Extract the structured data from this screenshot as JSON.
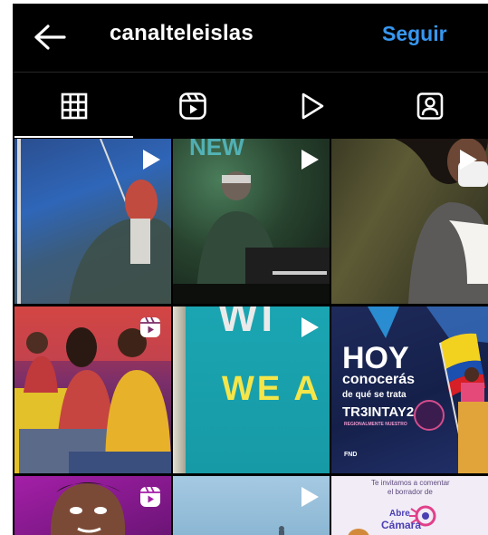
{
  "header": {
    "back_icon": "arrow-left-icon",
    "username": "canalteleislas",
    "follow_label": "Seguir"
  },
  "tabs": [
    {
      "icon": "grid-icon",
      "active": true
    },
    {
      "icon": "reels-icon",
      "active": false
    },
    {
      "icon": "play-icon",
      "active": false
    },
    {
      "icon": "tagged-person-icon",
      "active": false
    }
  ],
  "posts": [
    {
      "type": "video",
      "badge_icon": "play-icon"
    },
    {
      "type": "video",
      "badge_icon": "play-icon",
      "text": "NEW"
    },
    {
      "type": "video",
      "badge_icon": "play-icon"
    },
    {
      "type": "reel",
      "badge_icon": "reels-icon"
    },
    {
      "type": "video",
      "badge_icon": "play-icon",
      "text_top": "WI",
      "text_main": "WE A"
    },
    {
      "type": "image",
      "headline": "HOY",
      "line2": "conocerás",
      "line3": "de qué se trata",
      "brand": "TR3INTAY2",
      "brand_sub": "REGIONALMENTE NUESTRO",
      "footer": "FND"
    },
    {
      "type": "reel",
      "badge_icon": "reels-icon"
    },
    {
      "type": "video",
      "badge_icon": "play-icon"
    },
    {
      "type": "image",
      "line1": "Te invitamos a comentar",
      "line2": "el borrador de",
      "brand1": "Abre",
      "brand2": "Cámara"
    }
  ],
  "colors": {
    "background": "#000000",
    "accent": "#3797f0",
    "text": "#ffffff"
  }
}
